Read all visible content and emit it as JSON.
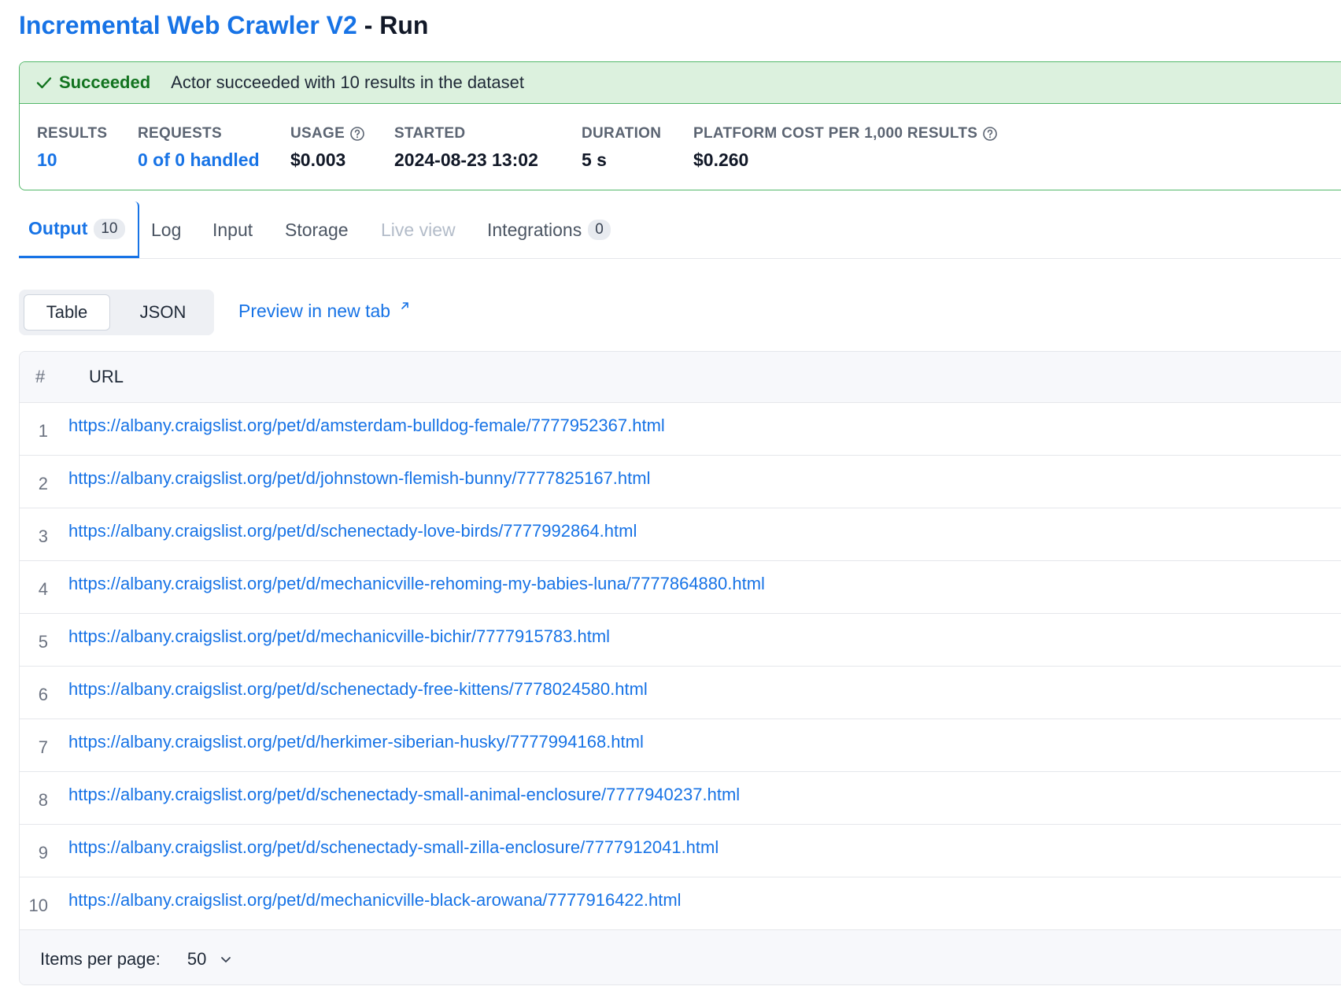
{
  "header": {
    "actor_name": "Incremental Web Crawler V2",
    "separator": " - ",
    "page_suffix": "Run"
  },
  "status": {
    "state": "Succeeded",
    "message": "Actor succeeded with 10 results in the dataset",
    "color": "#12731f",
    "banner_color": "#dcf1de"
  },
  "stats": {
    "results_label": "RESULTS",
    "results_value": "10",
    "requests_label": "REQUESTS",
    "requests_value": "0 of 0 handled",
    "usage_label": "USAGE",
    "usage_value": "$0.003",
    "started_label": "STARTED",
    "started_value": "2024-08-23 13:02",
    "duration_label": "DURATION",
    "duration_value": "5 s",
    "cost_label": "PLATFORM COST PER 1,000 RESULTS",
    "cost_value": "$0.260"
  },
  "tabs": [
    {
      "label": "Output",
      "badge": "10",
      "active": true,
      "disabled": false
    },
    {
      "label": "Log",
      "badge": null,
      "active": false,
      "disabled": false
    },
    {
      "label": "Input",
      "badge": null,
      "active": false,
      "disabled": false
    },
    {
      "label": "Storage",
      "badge": null,
      "active": false,
      "disabled": false
    },
    {
      "label": "Live view",
      "badge": null,
      "active": false,
      "disabled": true
    },
    {
      "label": "Integrations",
      "badge": "0",
      "active": false,
      "disabled": false
    }
  ],
  "view_toggle": {
    "table_label": "Table",
    "json_label": "JSON",
    "selected": "Table"
  },
  "preview_link": "Preview in new tab",
  "table": {
    "col_num": "#",
    "col_url": "URL",
    "rows": [
      {
        "num": "1",
        "url": "https://albany.craigslist.org/pet/d/amsterdam-bulldog-female/7777952367.html"
      },
      {
        "num": "2",
        "url": "https://albany.craigslist.org/pet/d/johnstown-flemish-bunny/7777825167.html"
      },
      {
        "num": "3",
        "url": "https://albany.craigslist.org/pet/d/schenectady-love-birds/7777992864.html"
      },
      {
        "num": "4",
        "url": "https://albany.craigslist.org/pet/d/mechanicville-rehoming-my-babies-luna/7777864880.html"
      },
      {
        "num": "5",
        "url": "https://albany.craigslist.org/pet/d/mechanicville-bichir/7777915783.html"
      },
      {
        "num": "6",
        "url": "https://albany.craigslist.org/pet/d/schenectady-free-kittens/7778024580.html"
      },
      {
        "num": "7",
        "url": "https://albany.craigslist.org/pet/d/herkimer-siberian-husky/7777994168.html"
      },
      {
        "num": "8",
        "url": "https://albany.craigslist.org/pet/d/schenectady-small-animal-enclosure/7777940237.html"
      },
      {
        "num": "9",
        "url": "https://albany.craigslist.org/pet/d/schenectady-small-zilla-enclosure/7777912041.html"
      },
      {
        "num": "10",
        "url": "https://albany.craigslist.org/pet/d/mechanicville-black-arowana/7777916422.html"
      }
    ]
  },
  "pagination": {
    "items_per_page_label": "Items per page:",
    "items_per_page_value": "50"
  },
  "colors": {
    "accent": "#1773e6",
    "success_border": "#53b86a"
  },
  "icons": {
    "status": "check-icon",
    "help": "help-circle-icon",
    "external": "external-link-icon",
    "dropdown": "chevron-down-icon"
  }
}
